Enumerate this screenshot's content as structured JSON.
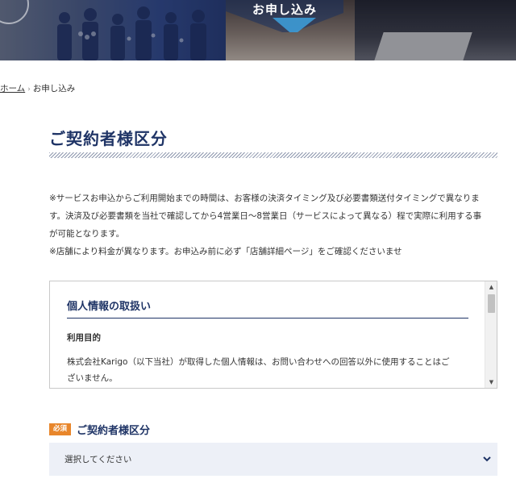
{
  "hero": {
    "title": "お申し込み"
  },
  "breadcrumb": {
    "home": "ホーム",
    "separator": "›",
    "current": "お申し込み"
  },
  "section": {
    "title": "ご契約者様区分"
  },
  "notice": {
    "line1": "※サービスお申込からご利用開始までの時間は、お客様の決済タイミング及び必要書類送付タイミングで異なりま",
    "line2": "す。決済及び必要書類を当社で確認してから4営業日～8営業日（サービスによって異なる）程で実際に利用する事",
    "line3": "が可能となります。",
    "line4": "※店舗により料金が異なります。お申込み前に必ず「店舗詳細ページ」をご確認くださいませ"
  },
  "privacy": {
    "heading": "個人情報の取扱い",
    "subheading": "利用目的",
    "body_line1": "株式会社Karigo（以下当社）が取得した個人情報は、お問い合わせへの回答以外に使用することはご",
    "body_line2": "ざいません。"
  },
  "form": {
    "required_label": "必須",
    "field_label": "ご契約者様区分",
    "select_placeholder": "選択してください"
  },
  "colors": {
    "navy": "#1f3466",
    "accent_orange": "#e8862b",
    "select_bg": "#edf0f7"
  },
  "icons": {
    "scroll_up": "triangle-up-icon",
    "scroll_down": "triangle-down-icon",
    "select_caret": "chevron-down-icon"
  }
}
